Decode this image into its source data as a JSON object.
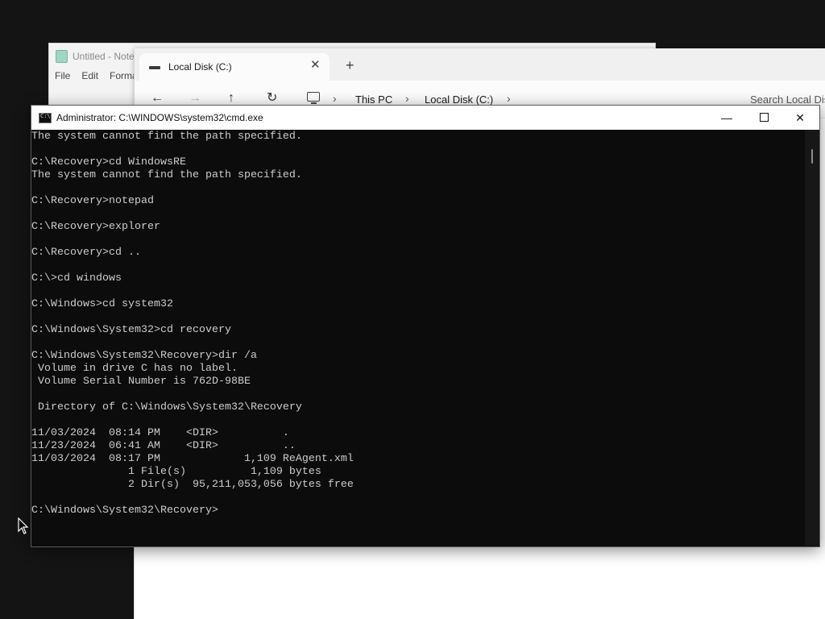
{
  "notepad": {
    "title": "Untitled - Notepad",
    "menu": [
      "File",
      "Edit",
      "Format"
    ]
  },
  "explorer": {
    "tab_label": "Local Disk (C:)",
    "new_tab": "+",
    "close_tab": "✕",
    "breadcrumbs": [
      "This PC",
      "Local Disk (C:)"
    ],
    "search_placeholder": "Search Local Disk (C:)"
  },
  "cmd": {
    "title": "Administrator: C:\\WINDOWS\\system32\\cmd.exe",
    "lines": [
      "The system cannot find the path specified.",
      "",
      "C:\\Recovery>cd WindowsRE",
      "The system cannot find the path specified.",
      "",
      "C:\\Recovery>notepad",
      "",
      "C:\\Recovery>explorer",
      "",
      "C:\\Recovery>cd ..",
      "",
      "C:\\>cd windows",
      "",
      "C:\\Windows>cd system32",
      "",
      "C:\\Windows\\System32>cd recovery",
      "",
      "C:\\Windows\\System32\\Recovery>dir /a",
      " Volume in drive C has no label.",
      " Volume Serial Number is 762D-98BE",
      "",
      " Directory of C:\\Windows\\System32\\Recovery",
      "",
      "11/03/2024  08:14 PM    <DIR>          .",
      "11/23/2024  06:41 AM    <DIR>          ..",
      "11/03/2024  08:17 PM             1,109 ReAgent.xml",
      "               1 File(s)          1,109 bytes",
      "               2 Dir(s)  95,211,053,056 bytes free",
      "",
      "C:\\Windows\\System32\\Recovery>"
    ],
    "buttons": {
      "minimize": "—",
      "close": "✕"
    }
  },
  "colors": {
    "console_bg": "#0c0c0c",
    "console_fg": "#cccccc",
    "desktop": "#141414"
  }
}
